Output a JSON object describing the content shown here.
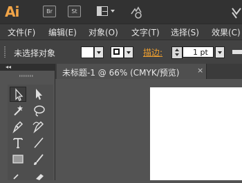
{
  "app": {
    "logo_text": "Ai",
    "bridge_label": "Br",
    "stock_label": "St"
  },
  "menu": [
    {
      "label": "文件(F)"
    },
    {
      "label": "编辑(E)"
    },
    {
      "label": "对象(O)"
    },
    {
      "label": "文字(T)"
    },
    {
      "label": "选择(S)"
    },
    {
      "label": "效果(C)"
    }
  ],
  "control": {
    "selection_label": "未选择对象",
    "stroke_label": "描边",
    "stroke_suffix": ":",
    "stroke_weight": "1 pt"
  },
  "document": {
    "tab_title": "未标题-1 @ 66% (CMYK/预览)",
    "close_glyph": "×"
  },
  "panel": {
    "collapse_glyph": "◂◂"
  },
  "colors": {
    "accent_orange": "#f2a548",
    "stroke_label": "#f0a030",
    "artboard": "#ffffff"
  },
  "tools": [
    {
      "name": "selection-tool-icon"
    },
    {
      "name": "direct-selection-tool-icon"
    },
    {
      "name": "magic-wand-tool-icon"
    },
    {
      "name": "lasso-tool-icon"
    },
    {
      "name": "pen-tool-icon"
    },
    {
      "name": "curvature-tool-icon"
    },
    {
      "name": "type-tool-icon"
    },
    {
      "name": "line-segment-tool-icon"
    },
    {
      "name": "rectangle-tool-icon"
    },
    {
      "name": "paintbrush-tool-icon"
    }
  ]
}
